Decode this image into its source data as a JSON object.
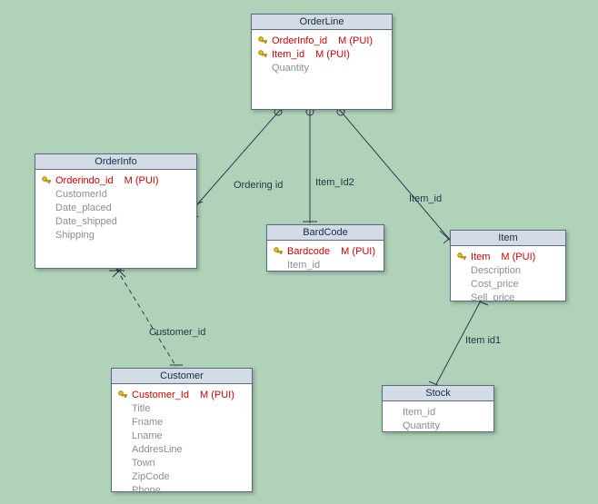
{
  "entities": {
    "orderline": {
      "title": "OrderLine",
      "attrs": [
        {
          "name": "OrderInfo_id",
          "note": "M (PUI)",
          "pk": true
        },
        {
          "name": "Item_id",
          "note": "M (PUI)",
          "pk": true
        },
        {
          "name": "Quantity",
          "note": "",
          "pk": false
        }
      ]
    },
    "orderinfo": {
      "title": "OrderInfo",
      "attrs": [
        {
          "name": "Orderindo_id",
          "note": "M (PUI)",
          "pk": true
        },
        {
          "name": "CustomerId",
          "note": "",
          "pk": false
        },
        {
          "name": "Date_placed",
          "note": "",
          "pk": false
        },
        {
          "name": "Date_shipped",
          "note": "",
          "pk": false
        },
        {
          "name": "Shipping",
          "note": "",
          "pk": false
        }
      ]
    },
    "barcode": {
      "title": "BardCode",
      "attrs": [
        {
          "name": "Bardcode",
          "note": "M (PUI)",
          "pk": true
        },
        {
          "name": "Item_id",
          "note": "",
          "pk": false
        }
      ]
    },
    "item": {
      "title": "Item",
      "attrs": [
        {
          "name": "Item",
          "note": "M (PUI)",
          "pk": true
        },
        {
          "name": "Description",
          "note": "",
          "pk": false
        },
        {
          "name": "Cost_price",
          "note": "",
          "pk": false
        },
        {
          "name": "Sell_price",
          "note": "",
          "pk": false
        }
      ]
    },
    "customer": {
      "title": "Customer",
      "attrs": [
        {
          "name": "Customer_Id",
          "note": "M (PUI)",
          "pk": true
        },
        {
          "name": "Title",
          "note": "",
          "pk": false
        },
        {
          "name": "Fname",
          "note": "",
          "pk": false
        },
        {
          "name": "Lname",
          "note": "",
          "pk": false
        },
        {
          "name": "AddresLine",
          "note": "",
          "pk": false
        },
        {
          "name": "Town",
          "note": "",
          "pk": false
        },
        {
          "name": "ZipCode",
          "note": "",
          "pk": false
        },
        {
          "name": "Phone",
          "note": "",
          "pk": false
        }
      ]
    },
    "stock": {
      "title": "Stock",
      "attrs": [
        {
          "name": "Item_id",
          "note": "",
          "pk": false
        },
        {
          "name": "Quantity",
          "note": "",
          "pk": false
        }
      ]
    }
  },
  "relations": {
    "ordering_id": "Ordering id",
    "item_id2": "Item_Id2",
    "item_id": "Item_id",
    "customer_id": "Customer_id",
    "item_id1": "Item id1"
  },
  "chart_data": {
    "type": "er-diagram",
    "entities": [
      {
        "name": "OrderLine",
        "attributes": [
          "OrderInfo_id (PK, M PUI)",
          "Item_id (PK, M PUI)",
          "Quantity"
        ]
      },
      {
        "name": "OrderInfo",
        "attributes": [
          "Orderindo_id (PK, M PUI)",
          "CustomerId",
          "Date_placed",
          "Date_shipped",
          "Shipping"
        ]
      },
      {
        "name": "BardCode",
        "attributes": [
          "Bardcode (PK, M PUI)",
          "Item_id"
        ]
      },
      {
        "name": "Item",
        "attributes": [
          "Item (PK, M PUI)",
          "Description",
          "Cost_price",
          "Sell_price"
        ]
      },
      {
        "name": "Customer",
        "attributes": [
          "Customer_Id (PK, M PUI)",
          "Title",
          "Fname",
          "Lname",
          "AddresLine",
          "Town",
          "ZipCode",
          "Phone"
        ]
      },
      {
        "name": "Stock",
        "attributes": [
          "Item_id",
          "Quantity"
        ]
      }
    ],
    "relationships": [
      {
        "from": "OrderLine",
        "to": "OrderInfo",
        "label": "Ordering id",
        "style": "solid",
        "from_card": "many",
        "to_card": "one-mandatory"
      },
      {
        "from": "OrderLine",
        "to": "BardCode",
        "label": "Item_Id2",
        "style": "solid",
        "from_card": "many",
        "to_card": "one"
      },
      {
        "from": "OrderLine",
        "to": "Item",
        "label": "Item_id",
        "style": "solid",
        "from_card": "many",
        "to_card": "one-mandatory"
      },
      {
        "from": "OrderInfo",
        "to": "Customer",
        "label": "Customer_id",
        "style": "dashed",
        "from_card": "many",
        "to_card": "one"
      },
      {
        "from": "Item",
        "to": "Stock",
        "label": "Item id1",
        "style": "solid",
        "from_card": "one-mandatory",
        "to_card": "one"
      }
    ]
  }
}
